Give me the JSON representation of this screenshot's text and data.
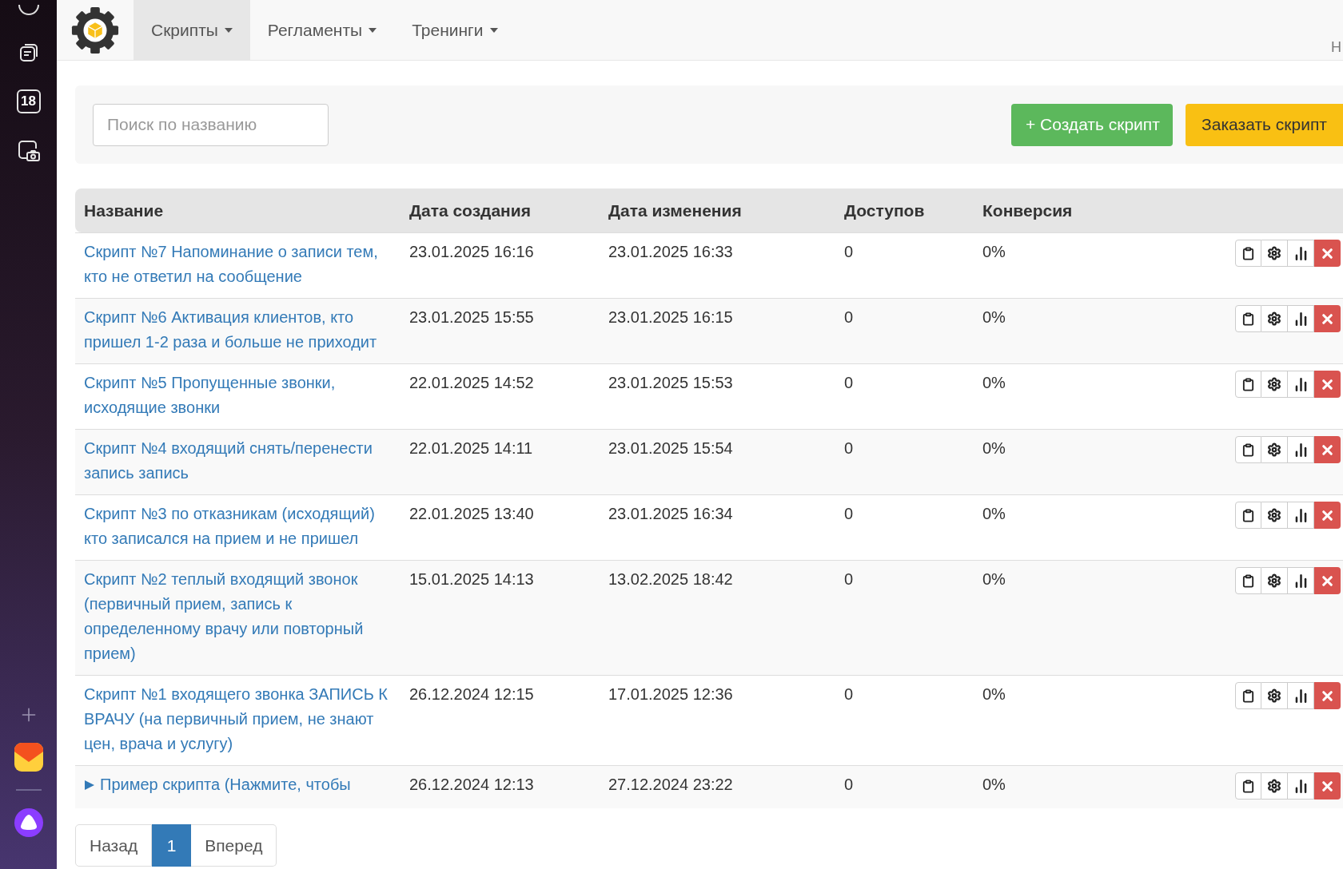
{
  "sidebar": {
    "items": [
      {
        "kind": "circle"
      },
      {
        "kind": "notes"
      },
      {
        "kind": "calendar",
        "label": "18"
      },
      {
        "kind": "screenshot"
      }
    ],
    "bottom_items": [
      {
        "kind": "plus"
      },
      {
        "kind": "mail"
      },
      {
        "kind": "divider"
      },
      {
        "kind": "assistant"
      }
    ]
  },
  "nav": {
    "tabs": [
      {
        "label": "Скрипты",
        "selected": true
      },
      {
        "label": "Регламенты",
        "selected": false
      },
      {
        "label": "Тренинги",
        "selected": false
      }
    ],
    "right_text": "Н"
  },
  "toolbar": {
    "search": {
      "placeholder": "Поиск по названию"
    },
    "buttons": [
      {
        "label": "+ Создать скрипт",
        "kind": "success"
      },
      {
        "label": "Заказать скрипт",
        "kind": "warning"
      }
    ]
  },
  "table": {
    "columns": [
      "Название",
      "Дата создания",
      "Дата изменения",
      "Доступов",
      "Конверсия"
    ],
    "rows": [
      {
        "kind": "script",
        "name": "Скрипт №7 Напоминание о записи тем, кто не ответил на сообщение",
        "created": "23.01.2025 16:16",
        "modified": "23.01.2025 16:33",
        "access": "0",
        "conversion": "0%"
      },
      {
        "kind": "script",
        "name": "Скрипт №6 Активация клиентов, кто пришел 1-2 раза и больше не приходит",
        "created": "23.01.2025 15:55",
        "modified": "23.01.2025 16:15",
        "access": "0",
        "conversion": "0%"
      },
      {
        "kind": "script",
        "name": "Скрипт №5 Пропущенные звонки, исходящие звонки",
        "created": "22.01.2025 14:52",
        "modified": "23.01.2025 15:53",
        "access": "0",
        "conversion": "0%"
      },
      {
        "kind": "script",
        "name": "Скрипт №4 входящий снять/перенести запись запись",
        "created": "22.01.2025 14:11",
        "modified": "23.01.2025 15:54",
        "access": "0",
        "conversion": "0%"
      },
      {
        "kind": "script",
        "name": "Скрипт №3 по отказникам (исходящий) кто записался на прием и не пришел",
        "created": "22.01.2025 13:40",
        "modified": "23.01.2025 16:34",
        "access": "0",
        "conversion": "0%"
      },
      {
        "kind": "script",
        "name": "Скрипт №2 теплый входящий звонок (первичный прием, запись к определенному врачу или повторный прием)",
        "created": "15.01.2025 14:13",
        "modified": "13.02.2025 18:42",
        "access": "0",
        "conversion": "0%"
      },
      {
        "kind": "script",
        "name": "Скрипт №1 входящего звонка ЗАПИСЬ К ВРАЧУ (на первичный прием, не знают цен, врача и услугу)",
        "created": "26.12.2024 12:15",
        "modified": "17.01.2025 12:36",
        "access": "0",
        "conversion": "0%"
      },
      {
        "kind": "example",
        "name": "Пример скрипта (Нажмите, чтобы",
        "created": "26.12.2024 12:13",
        "modified": "27.12.2024 23:22",
        "access": "0",
        "conversion": "0%"
      }
    ]
  },
  "pagination": {
    "prev": "Назад",
    "pages": [
      {
        "label": "1",
        "selected": true
      }
    ],
    "next": "Вперед"
  }
}
